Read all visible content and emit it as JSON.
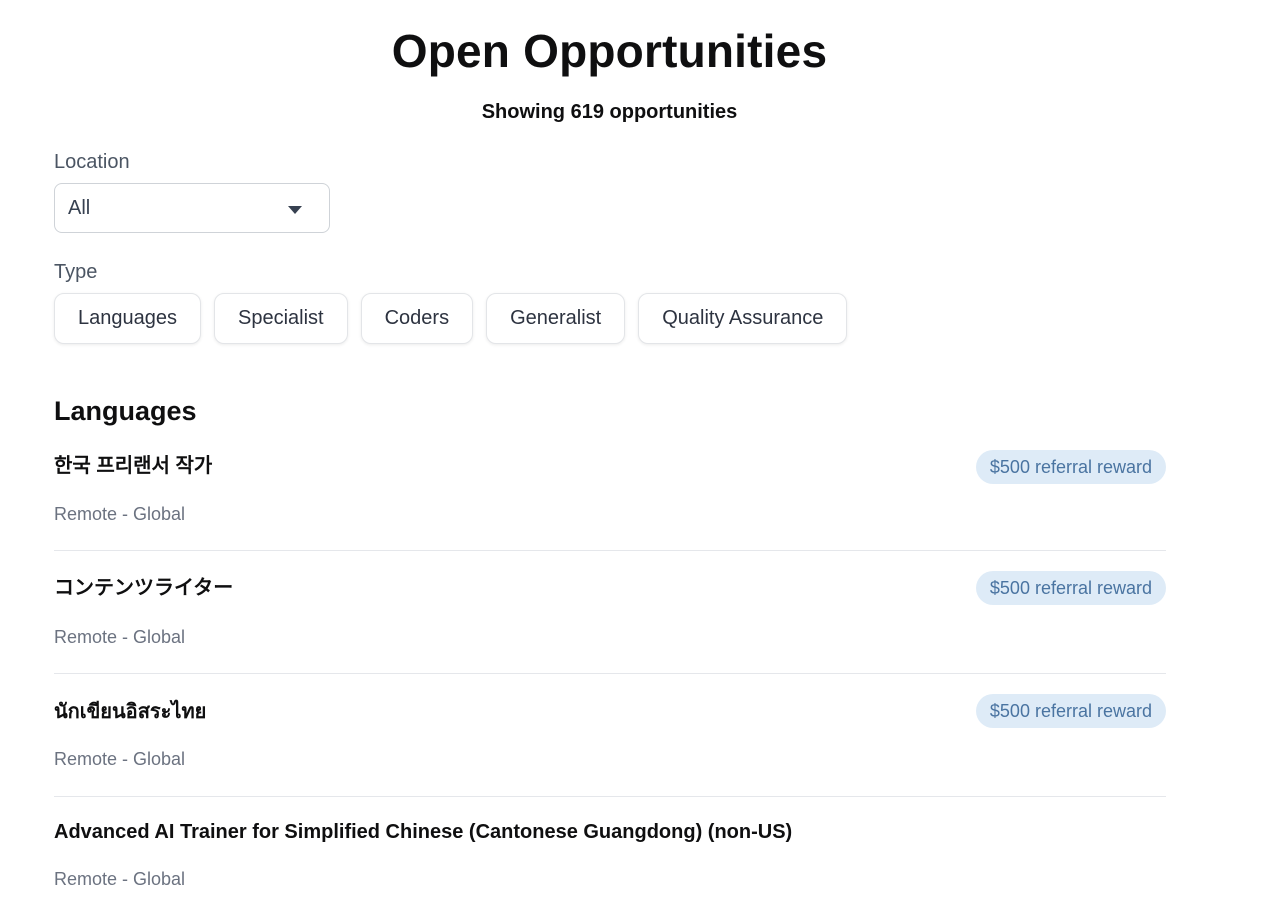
{
  "page": {
    "title": "Open Opportunities",
    "result_count": "Showing 619 opportunities"
  },
  "filters": {
    "location_label": "Location",
    "location_value": "All",
    "type_label": "Type",
    "types": [
      "Languages",
      "Specialist",
      "Coders",
      "Generalist",
      "Quality Assurance"
    ]
  },
  "section": {
    "heading": "Languages"
  },
  "jobs": [
    {
      "title": "한국 프리랜서 작가",
      "location": "Remote - Global",
      "reward": "$500 referral reward"
    },
    {
      "title": "コンテンツライター",
      "location": "Remote - Global",
      "reward": "$500 referral reward"
    },
    {
      "title": "นักเขียนอิสระไทย",
      "location": "Remote - Global",
      "reward": "$500 referral reward"
    },
    {
      "title": "Advanced AI Trainer for Simplified Chinese (Cantonese Guangdong) (non-US)",
      "location": "Remote - Global",
      "reward": ""
    }
  ],
  "colors": {
    "badge_bg": "#deebf7",
    "badge_text": "#4a74a1",
    "muted_text": "#6b7280"
  },
  "icons": {
    "select_caret": "chevron-down-icon"
  }
}
